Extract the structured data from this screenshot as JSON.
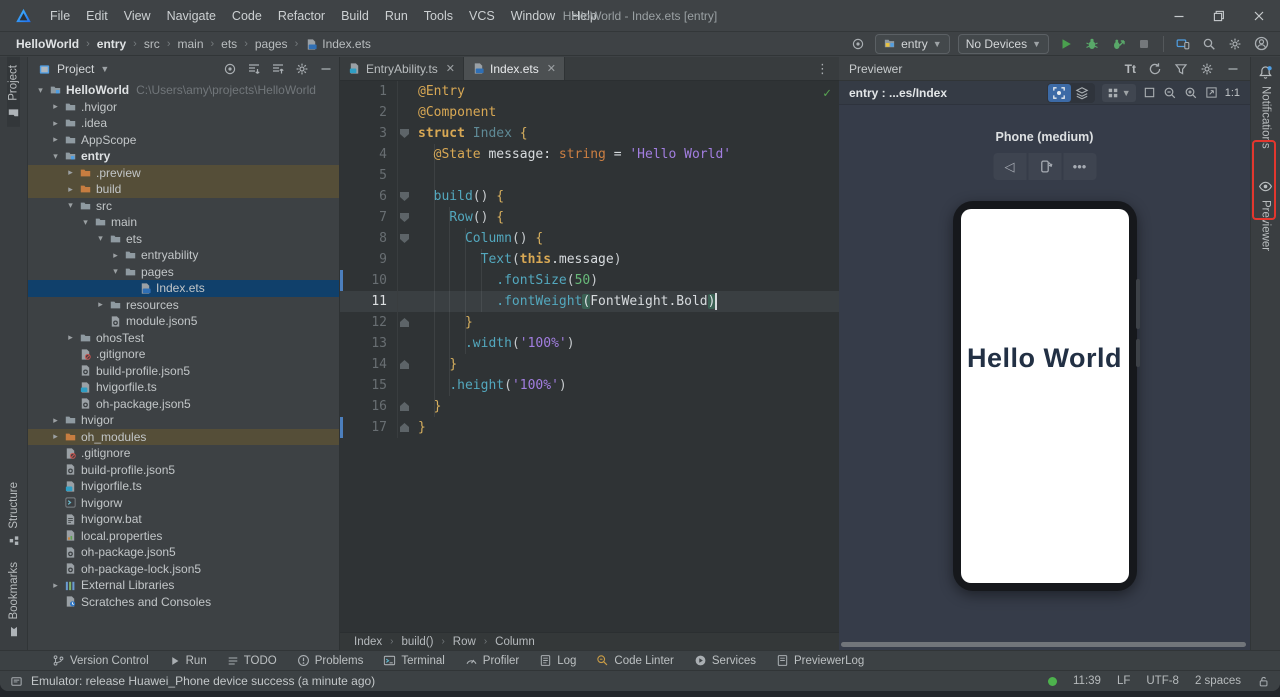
{
  "window": {
    "title": "HelloWorld - Index.ets [entry]"
  },
  "menu": {
    "items": [
      "File",
      "Edit",
      "View",
      "Navigate",
      "Code",
      "Refactor",
      "Build",
      "Run",
      "Tools",
      "VCS",
      "Window",
      "Help"
    ]
  },
  "toolbar": {
    "breadcrumbs": [
      {
        "label": "HelloWorld",
        "bold": true
      },
      {
        "label": "entry",
        "bold": true
      },
      {
        "label": "src",
        "bold": false
      },
      {
        "label": "main",
        "bold": false
      },
      {
        "label": "ets",
        "bold": false
      },
      {
        "label": "pages",
        "bold": false
      },
      {
        "label": "Index.ets",
        "bold": false,
        "icon": "file-ets"
      }
    ],
    "module_selector": "entry",
    "device_selector": "No Devices"
  },
  "activity_left": {
    "top": [
      "Project"
    ],
    "bottom": [
      "Structure",
      "Bookmarks"
    ]
  },
  "activity_right": [
    "Notifications",
    "Previewer"
  ],
  "project_panel": {
    "title": "Project",
    "tree": [
      {
        "label": "HelloWorld",
        "suffix": "C:\\Users\\amy\\projects\\HelloWorld",
        "level": 0,
        "arrow": "open",
        "icon": "folder-module",
        "bold": true
      },
      {
        "label": ".hvigor",
        "level": 1,
        "arrow": "closed",
        "icon": "folder"
      },
      {
        "label": ".idea",
        "level": 1,
        "arrow": "closed",
        "icon": "folder"
      },
      {
        "label": "AppScope",
        "level": 1,
        "arrow": "closed",
        "icon": "folder"
      },
      {
        "label": "entry",
        "level": 1,
        "arrow": "open",
        "icon": "folder-module",
        "bold": true
      },
      {
        "label": ".preview",
        "level": 2,
        "arrow": "closed",
        "icon": "folder-excluded",
        "row": "excluded"
      },
      {
        "label": "build",
        "level": 2,
        "arrow": "closed",
        "icon": "folder-excluded",
        "row": "excluded"
      },
      {
        "label": "src",
        "level": 2,
        "arrow": "open",
        "icon": "folder"
      },
      {
        "label": "main",
        "level": 3,
        "arrow": "open",
        "icon": "folder"
      },
      {
        "label": "ets",
        "level": 4,
        "arrow": "open",
        "icon": "folder"
      },
      {
        "label": "entryability",
        "level": 5,
        "arrow": "closed",
        "icon": "folder"
      },
      {
        "label": "pages",
        "level": 5,
        "arrow": "open",
        "icon": "folder"
      },
      {
        "label": "Index.ets",
        "level": 6,
        "arrow": "none",
        "icon": "file-ets",
        "row": "selected"
      },
      {
        "label": "resources",
        "level": 4,
        "arrow": "closed",
        "icon": "folder"
      },
      {
        "label": "module.json5",
        "level": 4,
        "arrow": "none",
        "icon": "file-json"
      },
      {
        "label": "ohosTest",
        "level": 2,
        "arrow": "closed",
        "icon": "folder"
      },
      {
        "label": ".gitignore",
        "level": 2,
        "arrow": "none",
        "icon": "file-git"
      },
      {
        "label": "build-profile.json5",
        "level": 2,
        "arrow": "none",
        "icon": "file-json"
      },
      {
        "label": "hvigorfile.ts",
        "level": 2,
        "arrow": "none",
        "icon": "file-ts"
      },
      {
        "label": "oh-package.json5",
        "level": 2,
        "arrow": "none",
        "icon": "file-json"
      },
      {
        "label": "hvigor",
        "level": 1,
        "arrow": "closed",
        "icon": "folder"
      },
      {
        "label": "oh_modules",
        "level": 1,
        "arrow": "closed",
        "icon": "folder-excluded",
        "row": "excluded"
      },
      {
        "label": ".gitignore",
        "level": 1,
        "arrow": "none",
        "icon": "file-git"
      },
      {
        "label": "build-profile.json5",
        "level": 1,
        "arrow": "none",
        "icon": "file-json"
      },
      {
        "label": "hvigorfile.ts",
        "level": 1,
        "arrow": "none",
        "icon": "file-ts"
      },
      {
        "label": "hvigorw",
        "level": 1,
        "arrow": "none",
        "icon": "file-exec"
      },
      {
        "label": "hvigorw.bat",
        "level": 1,
        "arrow": "none",
        "icon": "file-bat"
      },
      {
        "label": "local.properties",
        "level": 1,
        "arrow": "none",
        "icon": "file-props"
      },
      {
        "label": "oh-package.json5",
        "level": 1,
        "arrow": "none",
        "icon": "file-json"
      },
      {
        "label": "oh-package-lock.json5",
        "level": 1,
        "arrow": "none",
        "icon": "file-json"
      },
      {
        "label": "External Libraries",
        "level": 1,
        "arrow": "closed",
        "icon": "lib"
      },
      {
        "label": "Scratches and Consoles",
        "level": 1,
        "arrow": "none",
        "icon": "scratch"
      }
    ]
  },
  "editor": {
    "tabs": [
      {
        "label": "EntryAbility.ts",
        "icon": "file-ts",
        "active": false
      },
      {
        "label": "Index.ets",
        "icon": "file-ets",
        "active": true
      }
    ],
    "breadcrumbs": [
      "Index",
      "build()",
      "Row",
      "Column"
    ],
    "current_line": 11,
    "vcs_lines": [
      10,
      17
    ],
    "lines": [
      {
        "n": 1,
        "tokens": [
          [
            "dec",
            "@Entry"
          ]
        ]
      },
      {
        "n": 2,
        "tokens": [
          [
            "dec",
            "@Component"
          ]
        ]
      },
      {
        "n": 3,
        "fold": "open",
        "tokens": [
          [
            "kw",
            "struct"
          ],
          [
            "txt",
            " "
          ],
          [
            "type",
            "Index"
          ],
          [
            "txt",
            " "
          ],
          [
            "brace",
            "{"
          ]
        ]
      },
      {
        "n": 4,
        "tokens": [
          [
            "txt",
            "  "
          ],
          [
            "dec",
            "@State"
          ],
          [
            "txt",
            " message"
          ],
          [
            "op",
            ": "
          ],
          [
            "kwo",
            "string"
          ],
          [
            "op",
            " = "
          ],
          [
            "str",
            "'Hello World'"
          ]
        ]
      },
      {
        "n": 5,
        "tokens": []
      },
      {
        "n": 6,
        "fold": "open",
        "tokens": [
          [
            "txt",
            "  "
          ],
          [
            "fn",
            "build"
          ],
          [
            "par",
            "()"
          ],
          [
            "txt",
            " "
          ],
          [
            "brace",
            "{"
          ]
        ]
      },
      {
        "n": 7,
        "fold": "open",
        "tokens": [
          [
            "txt",
            "    "
          ],
          [
            "fn",
            "Row"
          ],
          [
            "par",
            "()"
          ],
          [
            "txt",
            " "
          ],
          [
            "brace",
            "{"
          ]
        ]
      },
      {
        "n": 8,
        "fold": "open",
        "tokens": [
          [
            "txt",
            "      "
          ],
          [
            "fn",
            "Column"
          ],
          [
            "par",
            "()"
          ],
          [
            "txt",
            " "
          ],
          [
            "brace",
            "{"
          ]
        ]
      },
      {
        "n": 9,
        "tokens": [
          [
            "txt",
            "        "
          ],
          [
            "fn",
            "Text"
          ],
          [
            "par",
            "("
          ],
          [
            "kw",
            "this"
          ],
          [
            "txt",
            ".message"
          ],
          [
            "par",
            ")"
          ]
        ]
      },
      {
        "n": 10,
        "tokens": [
          [
            "txt",
            "          "
          ],
          [
            "fn",
            ".fontSize"
          ],
          [
            "par",
            "("
          ],
          [
            "num",
            "50"
          ],
          [
            "par",
            ")"
          ]
        ]
      },
      {
        "n": 11,
        "tokens": [
          [
            "txt",
            "          "
          ],
          [
            "fn",
            ".fontWeight"
          ],
          [
            "parhl",
            "("
          ],
          [
            "txt",
            "FontWeight.Bold"
          ],
          [
            "parhl",
            ")"
          ]
        ]
      },
      {
        "n": 12,
        "fold": "close",
        "tokens": [
          [
            "txt",
            "      "
          ],
          [
            "brace",
            "}"
          ]
        ]
      },
      {
        "n": 13,
        "tokens": [
          [
            "txt",
            "      "
          ],
          [
            "fn",
            ".width"
          ],
          [
            "par",
            "("
          ],
          [
            "str",
            "'100%'"
          ],
          [
            "par",
            ")"
          ]
        ]
      },
      {
        "n": 14,
        "fold": "close",
        "tokens": [
          [
            "txt",
            "    "
          ],
          [
            "brace",
            "}"
          ]
        ]
      },
      {
        "n": 15,
        "tokens": [
          [
            "txt",
            "    "
          ],
          [
            "fn",
            ".height"
          ],
          [
            "par",
            "("
          ],
          [
            "str",
            "'100%'"
          ],
          [
            "par",
            ")"
          ]
        ]
      },
      {
        "n": 16,
        "fold": "close",
        "tokens": [
          [
            "txt",
            "  "
          ],
          [
            "brace",
            "}"
          ]
        ]
      },
      {
        "n": 17,
        "fold": "close",
        "tokens": [
          [
            "brace",
            "}"
          ]
        ]
      }
    ]
  },
  "previewer": {
    "title": "Previewer",
    "target": "entry : ...es/Index",
    "device_label": "Phone (medium)",
    "screen_text": "Hello World",
    "zoom_ratio": "1:1",
    "text_size_label": "Tt"
  },
  "bottom_bar": {
    "items": [
      {
        "icon": "branch",
        "label": "Version Control"
      },
      {
        "icon": "run-small",
        "label": "Run"
      },
      {
        "icon": "todo",
        "label": "TODO"
      },
      {
        "icon": "problems",
        "label": "Problems"
      },
      {
        "icon": "terminal",
        "label": "Terminal"
      },
      {
        "icon": "profiler",
        "label": "Profiler"
      },
      {
        "icon": "log",
        "label": "Log"
      },
      {
        "icon": "lint",
        "label": "Code Linter"
      },
      {
        "icon": "services",
        "label": "Services"
      },
      {
        "icon": "prevlog",
        "label": "PreviewerLog"
      }
    ]
  },
  "status_bar": {
    "message": "Emulator: release Huawei_Phone device success (a minute ago)",
    "right": [
      "11:39",
      "LF",
      "UTF-8",
      "2 spaces"
    ]
  },
  "colors": {
    "accent_blue": "#4f9ee3",
    "run_green": "#4aa04e",
    "selection_blue": "#10406b",
    "excluded_amber": "#554e38",
    "annotation_red": "#e3372e"
  }
}
